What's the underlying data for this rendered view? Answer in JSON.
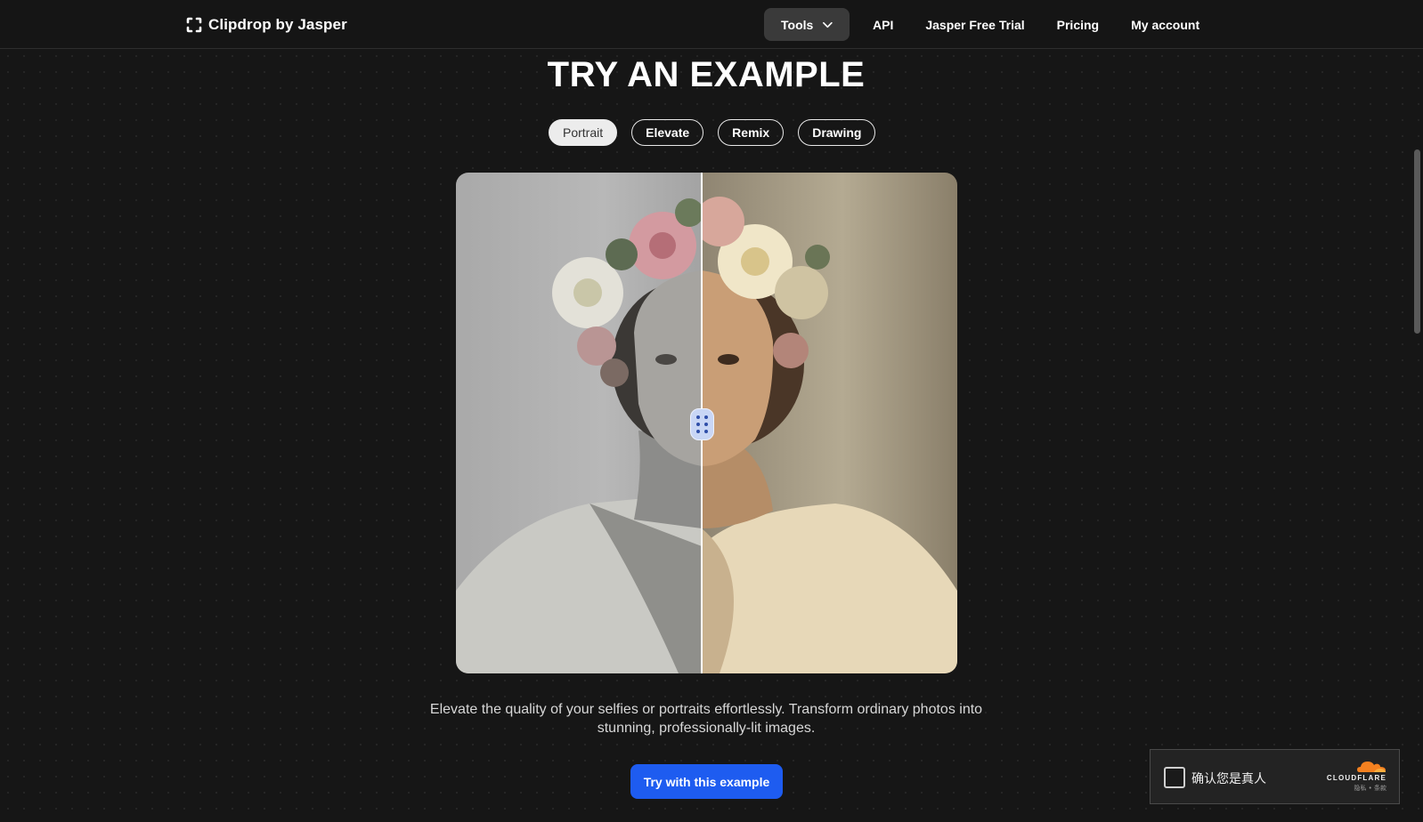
{
  "header": {
    "logo_text": "Clipdrop by Jasper",
    "nav": {
      "tools_label": "Tools",
      "api_label": "API",
      "trial_label": "Jasper Free Trial",
      "pricing_label": "Pricing",
      "account_label": "My account"
    }
  },
  "main": {
    "title": "TRY AN EXAMPLE",
    "tabs": [
      {
        "label": "Portrait",
        "active": true
      },
      {
        "label": "Elevate",
        "active": false
      },
      {
        "label": "Remix",
        "active": false
      },
      {
        "label": "Drawing",
        "active": false
      }
    ],
    "comparison": {
      "slider_position_percent": 49
    },
    "description_line1": "Elevate the quality of your selfies or portraits effortlessly. Transform ordinary photos into",
    "description_line2": "stunning, professionally-lit images.",
    "cta_label": "Try with this example"
  },
  "captcha": {
    "label": "确认您是真人",
    "brand": "CLOUDFLARE",
    "links": "隐私 • 条款"
  },
  "colors": {
    "background": "#161616",
    "accent": "#1e5cf0",
    "cloudflare_orange": "#f48120"
  },
  "icons": {
    "logo": "clipdrop-logo-icon",
    "tools_dropdown": "chevron-down-icon",
    "slider": "drag-handle-icon",
    "captcha_brand": "cloudflare-cloud-icon"
  }
}
